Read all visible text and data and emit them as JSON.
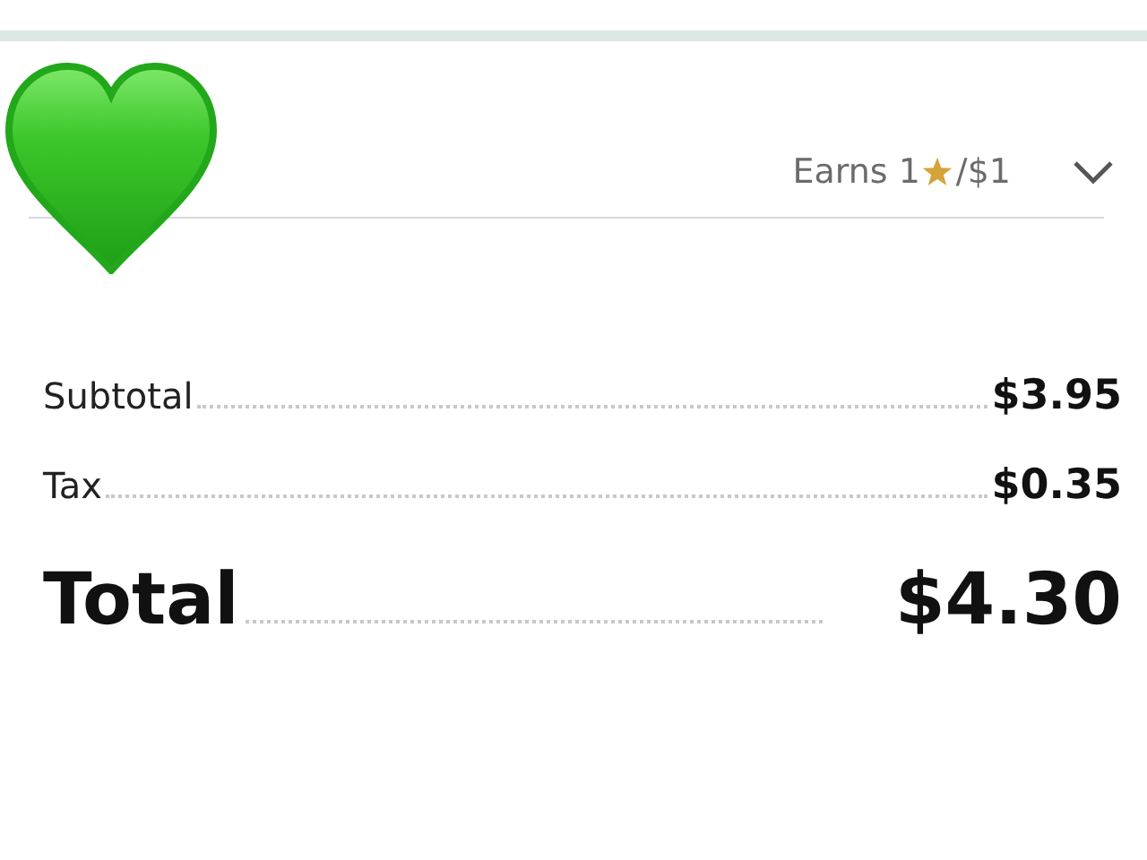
{
  "rewards": {
    "prefix": "Earns 1",
    "suffix": "/$1",
    "expanded": false
  },
  "lines": [
    {
      "kind": "normal",
      "label": "Subtotal",
      "amount": "$3.95"
    },
    {
      "kind": "normal",
      "label": "Tax",
      "amount": "$0.35"
    },
    {
      "kind": "total",
      "label": "Total",
      "amount": "$4.30"
    }
  ]
}
